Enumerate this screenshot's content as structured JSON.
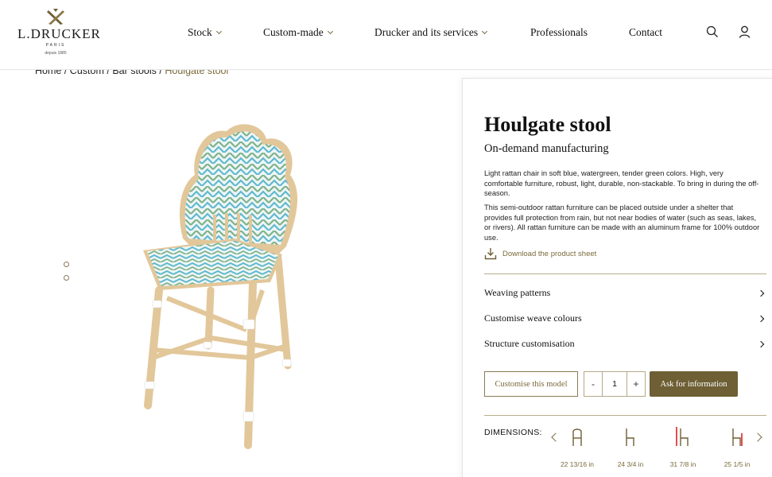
{
  "brand": {
    "name": "L.DRUCKER",
    "city": "PARIS",
    "since": "depuis 1885"
  },
  "nav": {
    "items": [
      {
        "label": "Stock",
        "has_dropdown": true
      },
      {
        "label": "Custom-made",
        "has_dropdown": true
      },
      {
        "label": "Drucker and its services",
        "has_dropdown": true
      },
      {
        "label": "Professionals",
        "has_dropdown": false
      },
      {
        "label": "Contact",
        "has_dropdown": false
      }
    ],
    "icons": [
      "search-icon",
      "user-icon"
    ]
  },
  "breadcrumb": {
    "items": [
      "Home",
      "Custom",
      "Bar stools"
    ],
    "separator": "/",
    "current": "Houlgate stool"
  },
  "gallery": {
    "dots": 2,
    "image": "rattan-bar-stool-image"
  },
  "product": {
    "title": "Houlgate stool",
    "subtitle": "On-demand manufacturing",
    "description_1": "Light rattan chair in soft blue, watergreen, tender green colors. High, very comfortable furniture, robust, light, durable, non-stackable. To bring in during the off-season.",
    "description_2": "This semi-outdoor rattan furniture can be placed outside under a shelter that provides full protection from rain, but not near bodies of water (such as seas, lakes, or rivers). All rattan furniture can be made with an aluminum frame for 100% outdoor use.",
    "download_label": "Download the product sheet"
  },
  "accordion": [
    {
      "label": "Weaving patterns"
    },
    {
      "label": "Customise weave colours"
    },
    {
      "label": "Structure customisation"
    }
  ],
  "actions": {
    "customise_label": "Customise this model",
    "qty_minus": "-",
    "qty_value": "1",
    "qty_plus": "+",
    "ask_label": "Ask for information"
  },
  "dimensions": {
    "label": "DIMENSIONS:",
    "items": [
      {
        "value": "22 13/16 in",
        "icon": "dimension-width-icon"
      },
      {
        "value": "24 3/4 in",
        "icon": "dimension-seat-height-icon"
      },
      {
        "value": "31 7/8 in",
        "icon": "dimension-depth-icon"
      },
      {
        "value": "25 1/5 in",
        "icon": "dimension-back-height-icon"
      }
    ]
  },
  "colors": {
    "accent": "#6e5f35",
    "accent_text": "#7a6a3a",
    "highlight_red": "#e02020",
    "rattan": "#e2c79a",
    "weave_blue": "#5fb8d0",
    "weave_green": "#7fb28a"
  }
}
